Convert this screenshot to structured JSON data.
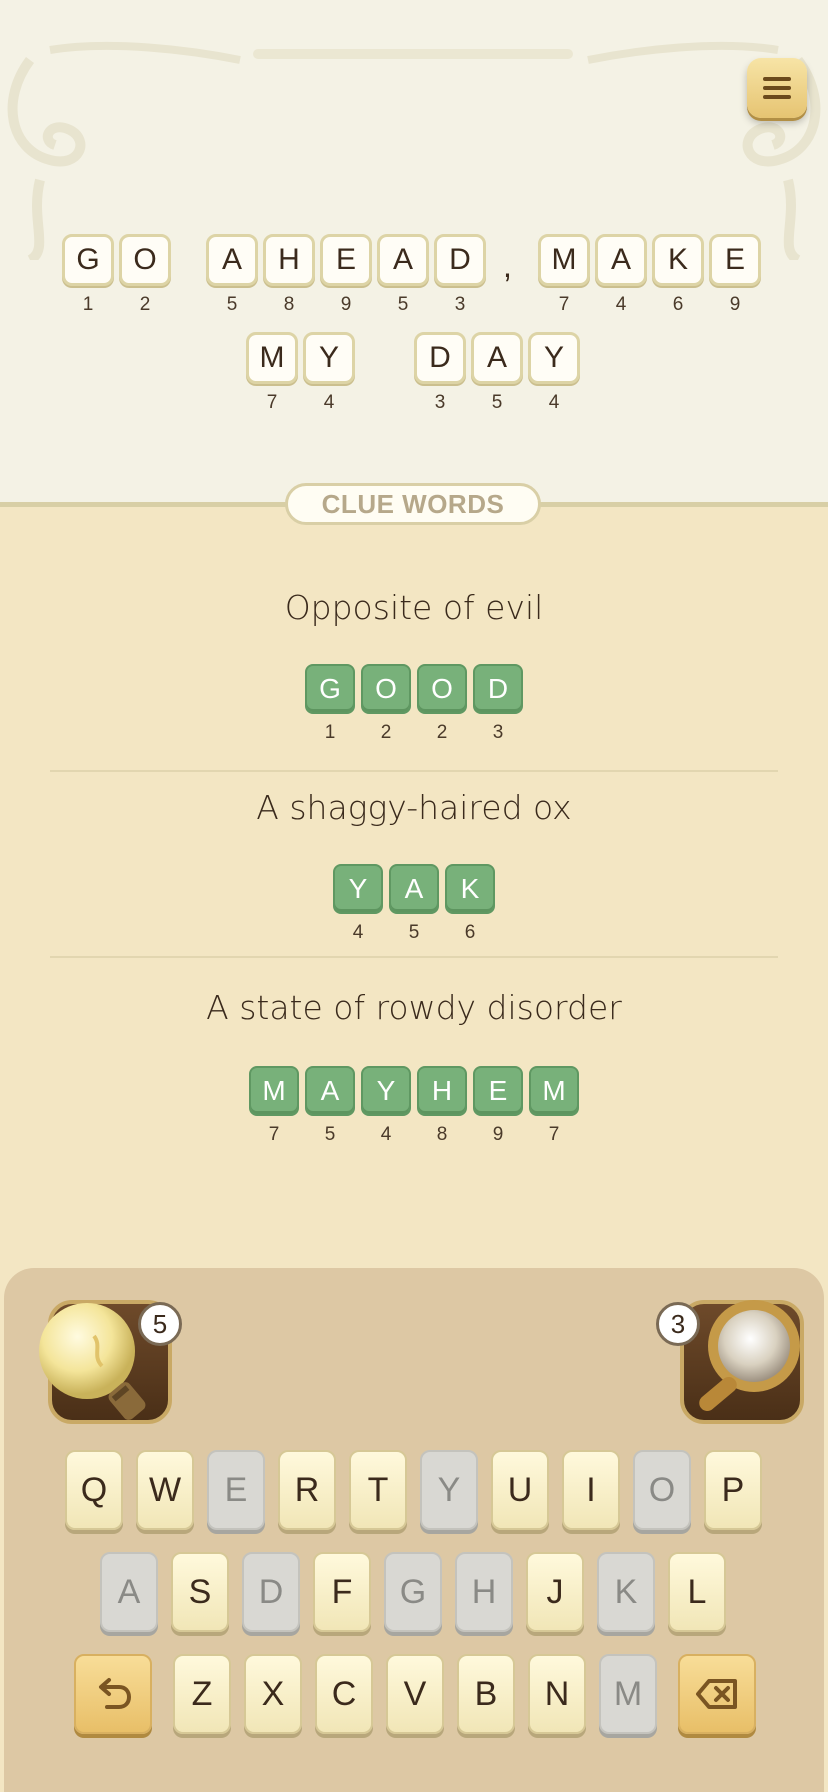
{
  "phrase": {
    "line1": [
      {
        "letter": "G",
        "num": "1"
      },
      {
        "letter": "O",
        "num": "2"
      },
      {
        "letter": "A",
        "num": "5"
      },
      {
        "letter": "H",
        "num": "8"
      },
      {
        "letter": "E",
        "num": "9"
      },
      {
        "letter": "A",
        "num": "5"
      },
      {
        "letter": "D",
        "num": "3"
      },
      {
        "letter": "M",
        "num": "7"
      },
      {
        "letter": "A",
        "num": "4"
      },
      {
        "letter": "K",
        "num": "6"
      },
      {
        "letter": "E",
        "num": "9"
      }
    ],
    "comma": ",",
    "line2": [
      {
        "letter": "M",
        "num": "7"
      },
      {
        "letter": "Y",
        "num": "4"
      },
      {
        "letter": "D",
        "num": "3"
      },
      {
        "letter": "A",
        "num": "5"
      },
      {
        "letter": "Y",
        "num": "4"
      }
    ]
  },
  "clue_words_label": "CLUE WORDS",
  "clues": [
    {
      "text": "Opposite of evil",
      "tiles": [
        {
          "letter": "G",
          "num": "1"
        },
        {
          "letter": "O",
          "num": "2"
        },
        {
          "letter": "O",
          "num": "2"
        },
        {
          "letter": "D",
          "num": "3"
        }
      ]
    },
    {
      "text": "A shaggy-haired ox",
      "tiles": [
        {
          "letter": "Y",
          "num": "4"
        },
        {
          "letter": "A",
          "num": "5"
        },
        {
          "letter": "K",
          "num": "6"
        }
      ]
    },
    {
      "text": "A state of rowdy disorder",
      "tiles": [
        {
          "letter": "M",
          "num": "7"
        },
        {
          "letter": "A",
          "num": "5"
        },
        {
          "letter": "Y",
          "num": "4"
        },
        {
          "letter": "H",
          "num": "8"
        },
        {
          "letter": "E",
          "num": "9"
        },
        {
          "letter": "M",
          "num": "7"
        }
      ]
    }
  ],
  "hints": {
    "bulb_count": "5",
    "magnifier_count": "3"
  },
  "keyboard": {
    "row1": [
      {
        "k": "Q",
        "used": false
      },
      {
        "k": "W",
        "used": false
      },
      {
        "k": "E",
        "used": true
      },
      {
        "k": "R",
        "used": false
      },
      {
        "k": "T",
        "used": false
      },
      {
        "k": "Y",
        "used": true
      },
      {
        "k": "U",
        "used": false
      },
      {
        "k": "I",
        "used": false
      },
      {
        "k": "O",
        "used": true
      },
      {
        "k": "P",
        "used": false
      }
    ],
    "row2": [
      {
        "k": "A",
        "used": true
      },
      {
        "k": "S",
        "used": false
      },
      {
        "k": "D",
        "used": true
      },
      {
        "k": "F",
        "used": false
      },
      {
        "k": "G",
        "used": true
      },
      {
        "k": "H",
        "used": true
      },
      {
        "k": "J",
        "used": false
      },
      {
        "k": "K",
        "used": true
      },
      {
        "k": "L",
        "used": false
      }
    ],
    "row3": [
      {
        "k": "Z",
        "used": false
      },
      {
        "k": "X",
        "used": false
      },
      {
        "k": "C",
        "used": false
      },
      {
        "k": "V",
        "used": false
      },
      {
        "k": "B",
        "used": false
      },
      {
        "k": "N",
        "used": false
      },
      {
        "k": "M",
        "used": true
      }
    ],
    "undo_icon": "undo-arrow-icon",
    "delete_icon": "backspace-icon"
  },
  "colors": {
    "tile_green": "#78b17a",
    "keyboard_bg": "#ddc8a4",
    "used_key": "#d9d8d3"
  }
}
